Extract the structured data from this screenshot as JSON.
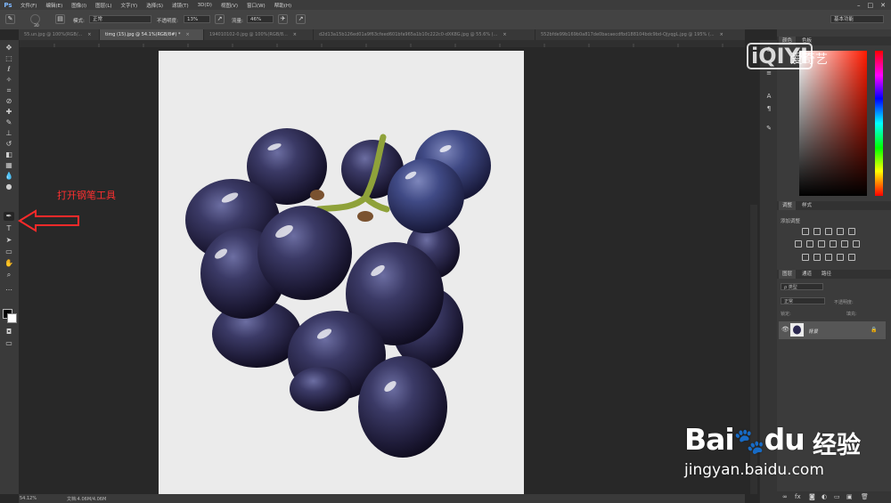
{
  "app": {
    "logo": "Ps"
  },
  "menubar": {
    "items": [
      "文件(F)",
      "编辑(E)",
      "图像(I)",
      "图层(L)",
      "文字(Y)",
      "选择(S)",
      "滤镜(T)",
      "3D(D)",
      "视图(V)",
      "窗口(W)",
      "帮助(H)"
    ],
    "window_controls": [
      "–",
      "□",
      "✕"
    ]
  },
  "options": {
    "brush_size": "30",
    "mode_label": "模式:",
    "mode_value": "正常",
    "opacity_label": "不透明度:",
    "opacity_value": "13%",
    "flow_label": "流量:",
    "flow_value": "46%",
    "workspace": "基本功能"
  },
  "tabs": [
    {
      "label": "55.un.jpg @ 100%(RGB/...",
      "active": false
    },
    {
      "label": "timg (15).jpg @ 54.1%(RGB/8#) *",
      "active": true
    },
    {
      "label": "194010102-0.jpg @ 100%(RGB/8...",
      "active": false
    },
    {
      "label": "d2d13a15b126ed01a9f63cfeed601bfa965a1b10c222c0-dXK8G.jpg @ 55.6% (...",
      "active": false
    },
    {
      "label": "552bfde99b169b0a817de0bacaecdfbd188104bdc9bd-QjyqgL.jpg @ 195% (...",
      "active": false
    }
  ],
  "annotation": {
    "text": "打开钢笔工具"
  },
  "status": {
    "zoom": "54.12%",
    "doc_size": "文档:4.06M/4.06M"
  },
  "panels": {
    "color_tabs": [
      "颜色",
      "色板"
    ],
    "adjust_tabs": [
      "调整",
      "样式"
    ],
    "adjust_label": "添加调整",
    "layers_tabs": [
      "图层",
      "通道",
      "路径"
    ],
    "kind_label": "ρ 类型",
    "blend_mode": "正常",
    "opacity_label": "不透明度:",
    "lock_label": "锁定:",
    "fill_label": "填充:",
    "layer_name": "背景"
  },
  "watermarks": {
    "iqiyi_logo": "iQIYI",
    "iqiyi_cn": "爱奇艺",
    "baidu_word": "Bai",
    "baidu_paw": "du",
    "baidu_jy": "经验",
    "baidu_url": "jingyan.baidu.com"
  },
  "colors": {
    "annotation": "#ff3030",
    "canvas_bg": "#ebebeb",
    "app_bg": "#282828"
  }
}
